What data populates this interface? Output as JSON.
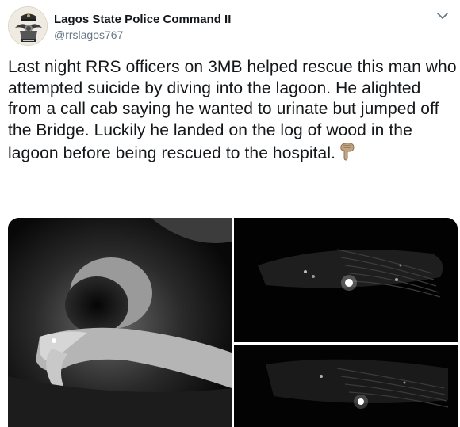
{
  "tweet": {
    "author": {
      "display_name": "Lagos State Police Command II",
      "handle": "@rrslagos767",
      "avatar_icon": "police-badge-icon"
    },
    "menu_icon": "chevron-down-icon",
    "text": "Last night RRS officers on 3MB helped rescue this man who attempted suicide by diving into the lagoon. He alighted from a call cab saying he wanted to urinate but jumped off the Bridge. Luckily he landed on the log of wood in the lagoon before being rescued to the hospital.",
    "emoji_icon": "pointing-down-hand-icon",
    "media": {
      "count": 3,
      "photos": [
        {
          "name": "photo-man-rescued"
        },
        {
          "name": "photo-lagoon-night-1"
        },
        {
          "name": "photo-lagoon-night-2"
        }
      ]
    }
  },
  "colors": {
    "text": "#14171a",
    "secondary": "#657786",
    "emoji_skin": "#c3a481"
  }
}
